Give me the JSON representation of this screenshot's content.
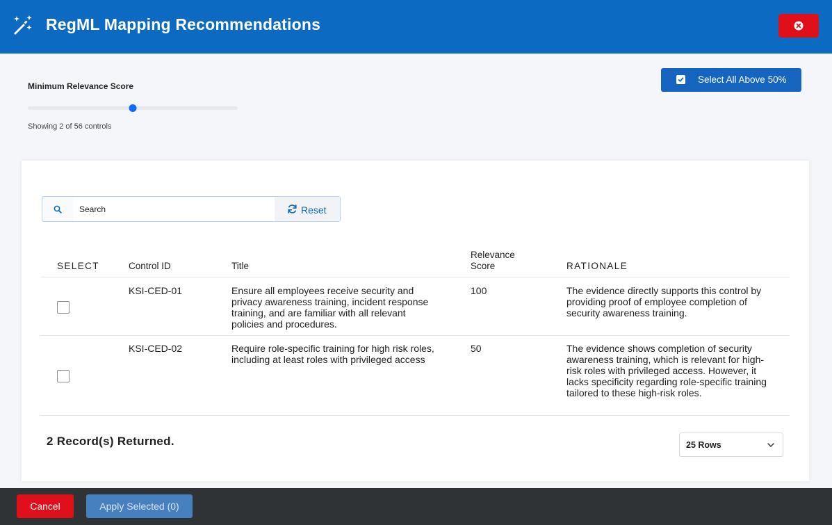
{
  "header": {
    "title": "RegML Mapping Recommendations",
    "icon": "magic-wand-icon",
    "close_icon": "close-circle-icon"
  },
  "filter": {
    "slider_label": "Minimum Relevance Score",
    "slider_value_percent": 50,
    "showing_text": "Showing 2 of 56 controls",
    "select_all_label": "Select All Above 50%"
  },
  "search": {
    "placeholder": "Search",
    "reset_label": "Reset"
  },
  "table": {
    "headers": {
      "select": "SELECT",
      "control_id": "Control ID",
      "title": "Title",
      "relevance_line1": "Relevance",
      "relevance_line2": "Score",
      "rationale": "RATIONALE"
    },
    "rows": [
      {
        "control_id": "KSI-CED-01",
        "title": "Ensure all employees receive security and privacy awareness training, incident response training, and are familiar with all relevant policies and procedures.",
        "relevance_score": "100",
        "rationale": "The evidence directly supports this control by providing proof of employee completion of security awareness training.",
        "selected": false
      },
      {
        "control_id": "KSI-CED-02",
        "title": "Require role-specific training for high risk roles, including at least roles with privileged access",
        "relevance_score": "50",
        "rationale": "The evidence shows completion of security awareness training, which is relevant for high-risk roles with privileged access. However, it lacks specificity regarding role-specific training tailored to these high-risk roles.",
        "selected": false
      }
    ]
  },
  "pagination": {
    "records_text": "2 Record(s) Returned.",
    "rows_label": "25 Rows"
  },
  "footer": {
    "cancel_label": "Cancel",
    "apply_label": "Apply Selected (0)"
  },
  "colors": {
    "header_bg": "#0d6ac2",
    "danger": "#e0101b",
    "primary": "#1565c0",
    "footer_bg": "#2f3336"
  }
}
